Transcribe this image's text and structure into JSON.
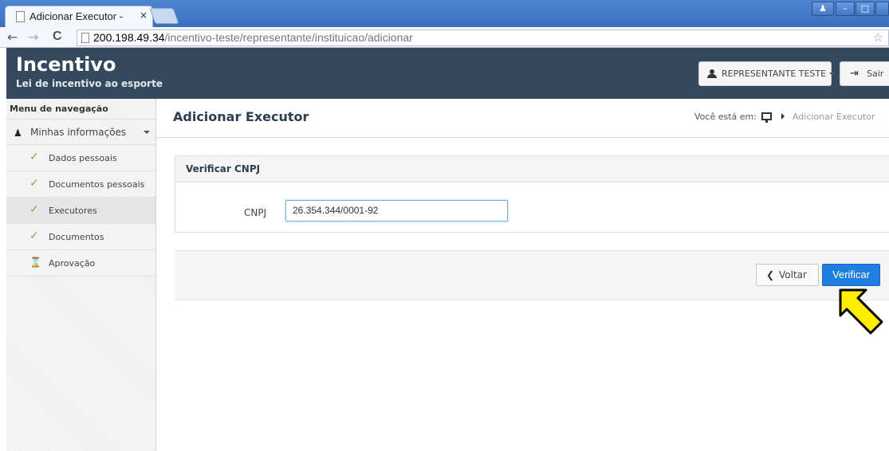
{
  "browser": {
    "tab_title": "Adicionar Executor -",
    "tab_close": "×",
    "url_host": "200.198.49.34",
    "url_path": "/incentivo-teste/representante/instituicao/adicionar",
    "back_glyph": "←",
    "forward_glyph": "→",
    "reload_glyph": "C",
    "star_glyph": "☆"
  },
  "header": {
    "brand_title": "Incentivo",
    "brand_subtitle": "Lei de incentivo ao esporte",
    "user_label": "REPRESENTANTE TESTE",
    "logout_label": "Sair"
  },
  "sidebar": {
    "heading": "Menu de navegação",
    "group_label": "Minhas informações",
    "items": [
      {
        "label": "Dados pessoais",
        "icon": "check-icon",
        "active": false
      },
      {
        "label": "Documentos pessoais",
        "icon": "check-icon",
        "active": false
      },
      {
        "label": "Executores",
        "icon": "check-icon",
        "active": true
      },
      {
        "label": "Documentos",
        "icon": "check-icon",
        "active": false
      },
      {
        "label": "Aprovação",
        "icon": "hourglass-icon",
        "active": false
      }
    ]
  },
  "main": {
    "page_title": "Adicionar Executor",
    "breadcrumb_prefix": "Você está em:",
    "breadcrumb_current": "Adicionar Executor",
    "panel_title": "Verificar CNPJ",
    "cnpj_label": "CNPJ",
    "cnpj_value": "26.354.344/0001-92",
    "back_label": "Voltar",
    "verify_label": "Verificar"
  },
  "colors": {
    "header_bg": "#34495e",
    "primary_button": "#1e7fe0",
    "check_green": "#6ab04c",
    "annotation_arrow": "#ffee00"
  }
}
